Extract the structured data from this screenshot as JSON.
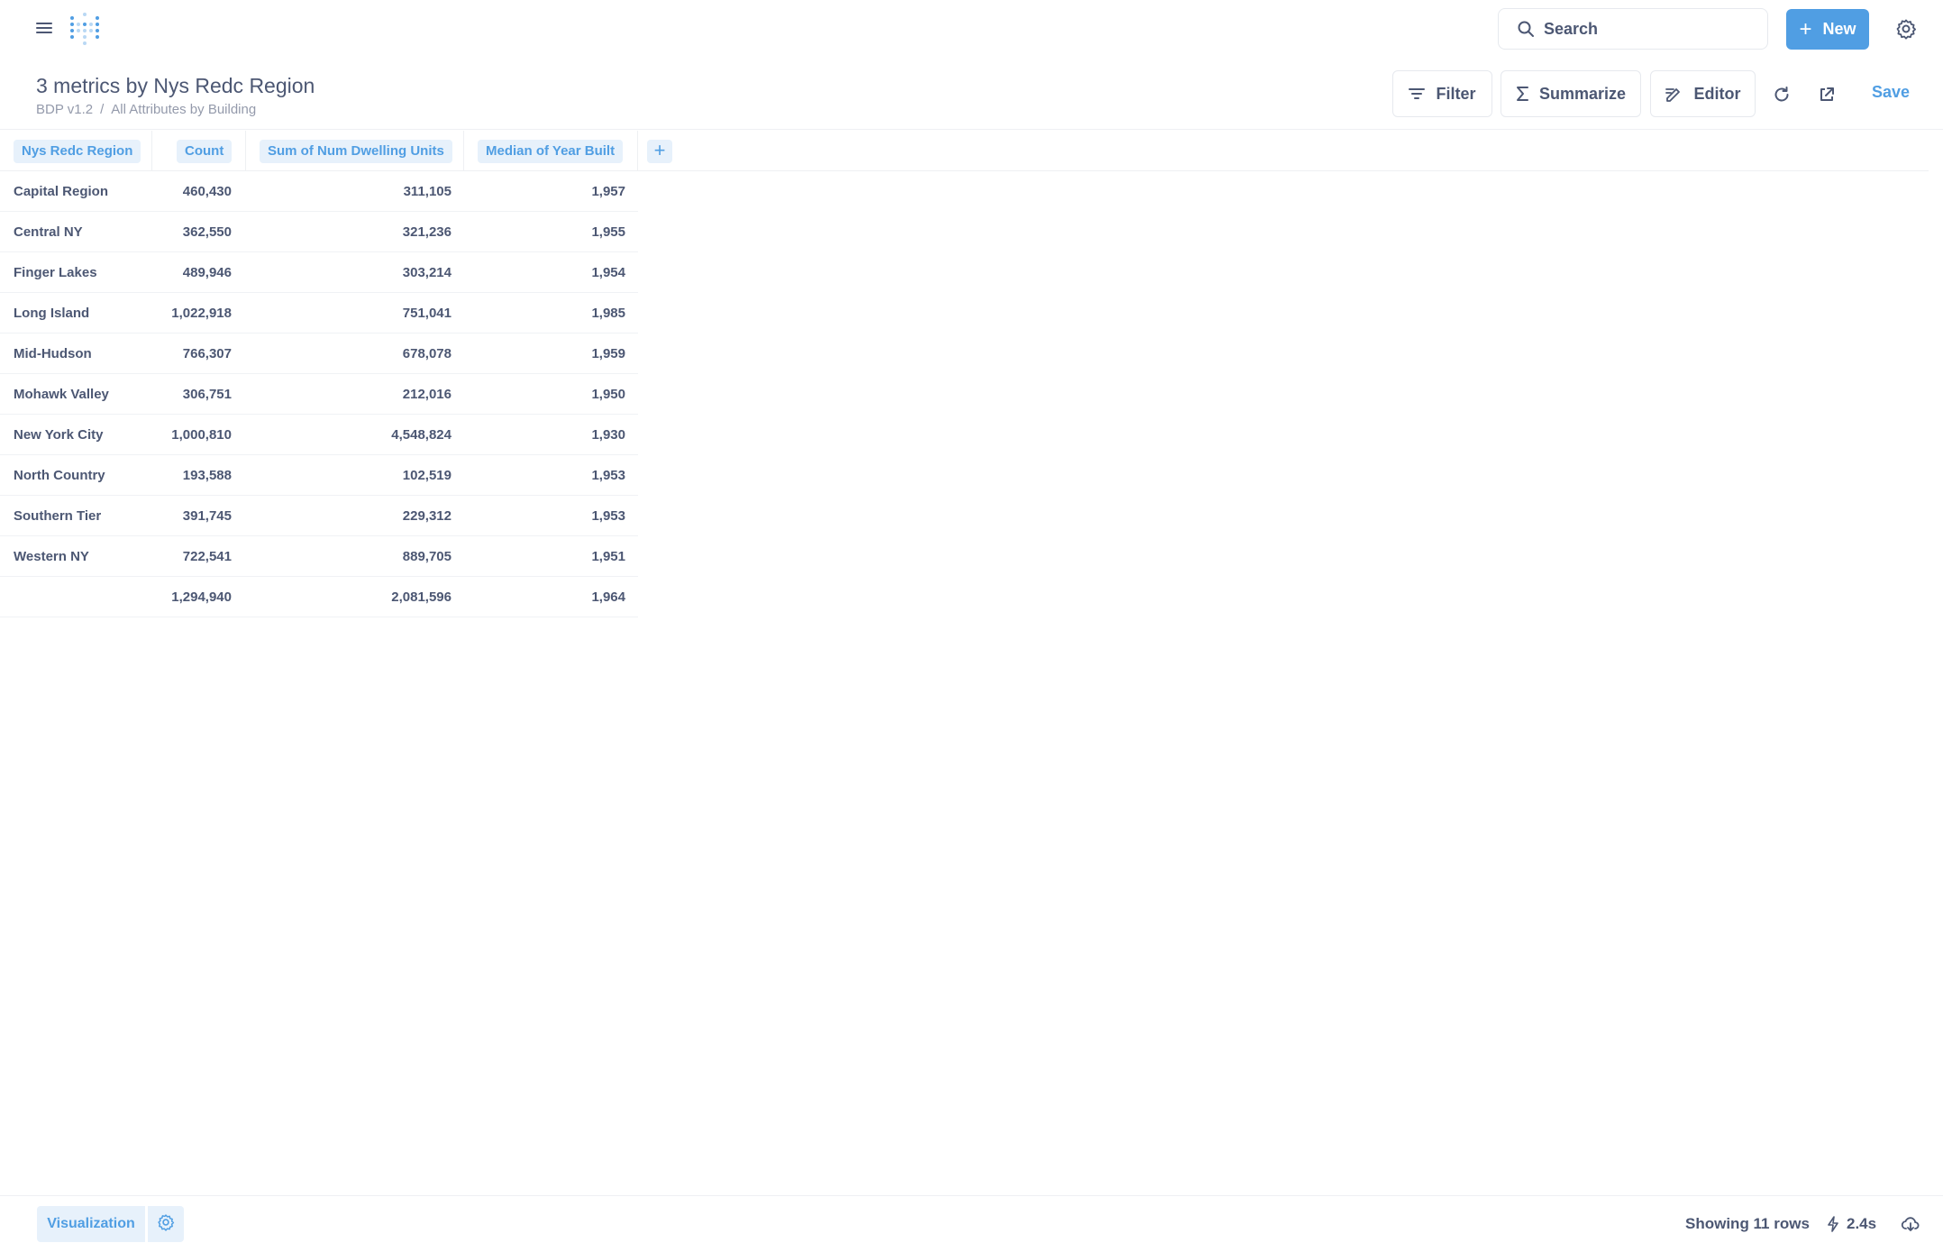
{
  "nav": {
    "search_placeholder": "Search",
    "new_label": "New"
  },
  "header": {
    "title": "3 metrics by Nys Redc Region",
    "breadcrumb": [
      "BDP v1.2",
      "All Attributes by Building"
    ],
    "filter_label": "Filter",
    "summarize_label": "Summarize",
    "editor_label": "Editor",
    "save_label": "Save"
  },
  "table": {
    "columns": [
      "Nys Redc Region",
      "Count",
      "Sum of Num Dwelling Units",
      "Median of Year Built"
    ],
    "rows": [
      [
        "Capital Region",
        "460,430",
        "311,105",
        "1,957"
      ],
      [
        "Central NY",
        "362,550",
        "321,236",
        "1,955"
      ],
      [
        "Finger Lakes",
        "489,946",
        "303,214",
        "1,954"
      ],
      [
        "Long Island",
        "1,022,918",
        "751,041",
        "1,985"
      ],
      [
        "Mid-Hudson",
        "766,307",
        "678,078",
        "1,959"
      ],
      [
        "Mohawk Valley",
        "306,751",
        "212,016",
        "1,950"
      ],
      [
        "New York City",
        "1,000,810",
        "4,548,824",
        "1,930"
      ],
      [
        "North Country",
        "193,588",
        "102,519",
        "1,953"
      ],
      [
        "Southern Tier",
        "391,745",
        "229,312",
        "1,953"
      ],
      [
        "Western NY",
        "722,541",
        "889,705",
        "1,951"
      ],
      [
        "",
        "1,294,940",
        "2,081,596",
        "1,964"
      ]
    ]
  },
  "footer": {
    "visualization_label": "Visualization",
    "row_count": "Showing 11 rows",
    "timing": "2.4s"
  },
  "colors": {
    "brand": "#509ee3",
    "text": "#4c5773",
    "muted": "#949aab",
    "pill_bg": "#e7f1fb"
  },
  "icons": [
    "hamburger-icon",
    "metabase-logo",
    "search-icon",
    "plus-icon",
    "gear-icon",
    "filter-icon",
    "sigma-icon",
    "editor-icon",
    "refresh-icon",
    "share-icon",
    "bolt-icon",
    "download-icon"
  ]
}
